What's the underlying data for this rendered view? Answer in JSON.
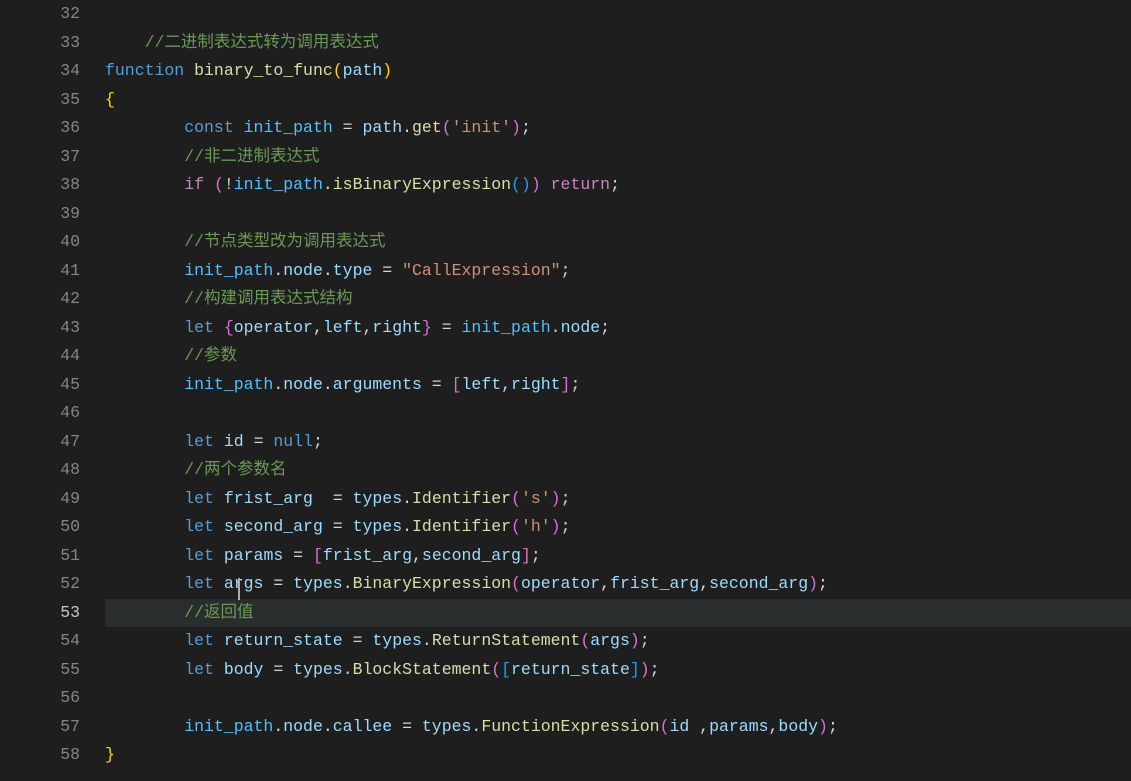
{
  "editor": {
    "activeLine": 53,
    "lines": [
      {
        "num": 32,
        "indent": 0
      },
      {
        "num": 33,
        "indent": 1,
        "tokens": [
          {
            "t": "comment",
            "v": "//二进制表达式转为调用表达式"
          }
        ]
      },
      {
        "num": 34,
        "indent": 0,
        "tokens": [
          {
            "t": "keyword-decl",
            "v": "function"
          },
          {
            "t": "punct",
            "v": " "
          },
          {
            "t": "func-name",
            "v": "binary_to_func"
          },
          {
            "t": "brace",
            "v": "("
          },
          {
            "t": "var",
            "v": "path"
          },
          {
            "t": "brace",
            "v": ")"
          }
        ]
      },
      {
        "num": 35,
        "indent": 0,
        "tokens": [
          {
            "t": "brace",
            "v": "{"
          }
        ]
      },
      {
        "num": 36,
        "indent": 2,
        "tokens": [
          {
            "t": "keyword-decl",
            "v": "const"
          },
          {
            "t": "punct",
            "v": " "
          },
          {
            "t": "const",
            "v": "init_path"
          },
          {
            "t": "punct",
            "v": " "
          },
          {
            "t": "operator",
            "v": "="
          },
          {
            "t": "punct",
            "v": " "
          },
          {
            "t": "var",
            "v": "path"
          },
          {
            "t": "punct",
            "v": "."
          },
          {
            "t": "func-name",
            "v": "get"
          },
          {
            "t": "brace2",
            "v": "("
          },
          {
            "t": "string",
            "v": "'init'"
          },
          {
            "t": "brace2",
            "v": ")"
          },
          {
            "t": "punct",
            "v": ";"
          }
        ]
      },
      {
        "num": 37,
        "indent": 2,
        "tokens": [
          {
            "t": "comment",
            "v": "//非二进制表达式"
          }
        ]
      },
      {
        "num": 38,
        "indent": 2,
        "tokens": [
          {
            "t": "keyword-ctrl",
            "v": "if"
          },
          {
            "t": "punct",
            "v": " "
          },
          {
            "t": "brace2",
            "v": "("
          },
          {
            "t": "operator",
            "v": "!"
          },
          {
            "t": "const",
            "v": "init_path"
          },
          {
            "t": "punct",
            "v": "."
          },
          {
            "t": "func-name",
            "v": "isBinaryExpression"
          },
          {
            "t": "brace3",
            "v": "("
          },
          {
            "t": "brace3",
            "v": ")"
          },
          {
            "t": "brace2",
            "v": ")"
          },
          {
            "t": "punct",
            "v": " "
          },
          {
            "t": "keyword-ctrl",
            "v": "return"
          },
          {
            "t": "punct",
            "v": ";"
          }
        ]
      },
      {
        "num": 39,
        "indent": 0
      },
      {
        "num": 40,
        "indent": 2,
        "tokens": [
          {
            "t": "comment",
            "v": "//节点类型改为调用表达式"
          }
        ]
      },
      {
        "num": 41,
        "indent": 2,
        "tokens": [
          {
            "t": "const",
            "v": "init_path"
          },
          {
            "t": "punct",
            "v": "."
          },
          {
            "t": "var",
            "v": "node"
          },
          {
            "t": "punct",
            "v": "."
          },
          {
            "t": "var",
            "v": "type"
          },
          {
            "t": "punct",
            "v": " "
          },
          {
            "t": "operator",
            "v": "="
          },
          {
            "t": "punct",
            "v": " "
          },
          {
            "t": "string",
            "v": "\"CallExpression\""
          },
          {
            "t": "punct",
            "v": ";"
          }
        ]
      },
      {
        "num": 42,
        "indent": 2,
        "tokens": [
          {
            "t": "comment",
            "v": "//构建调用表达式结构"
          }
        ]
      },
      {
        "num": 43,
        "indent": 2,
        "tokens": [
          {
            "t": "keyword-decl",
            "v": "let"
          },
          {
            "t": "punct",
            "v": " "
          },
          {
            "t": "brace2",
            "v": "{"
          },
          {
            "t": "var",
            "v": "operator"
          },
          {
            "t": "punct",
            "v": ","
          },
          {
            "t": "var",
            "v": "left"
          },
          {
            "t": "punct",
            "v": ","
          },
          {
            "t": "var",
            "v": "right"
          },
          {
            "t": "brace2",
            "v": "}"
          },
          {
            "t": "punct",
            "v": " "
          },
          {
            "t": "operator",
            "v": "="
          },
          {
            "t": "punct",
            "v": " "
          },
          {
            "t": "const",
            "v": "init_path"
          },
          {
            "t": "punct",
            "v": "."
          },
          {
            "t": "var",
            "v": "node"
          },
          {
            "t": "punct",
            "v": ";"
          }
        ]
      },
      {
        "num": 44,
        "indent": 2,
        "tokens": [
          {
            "t": "comment",
            "v": "//参数"
          }
        ]
      },
      {
        "num": 45,
        "indent": 2,
        "tokens": [
          {
            "t": "const",
            "v": "init_path"
          },
          {
            "t": "punct",
            "v": "."
          },
          {
            "t": "var",
            "v": "node"
          },
          {
            "t": "punct",
            "v": "."
          },
          {
            "t": "var",
            "v": "arguments"
          },
          {
            "t": "punct",
            "v": " "
          },
          {
            "t": "operator",
            "v": "="
          },
          {
            "t": "punct",
            "v": " "
          },
          {
            "t": "brace2",
            "v": "["
          },
          {
            "t": "var",
            "v": "left"
          },
          {
            "t": "punct",
            "v": ","
          },
          {
            "t": "var",
            "v": "right"
          },
          {
            "t": "brace2",
            "v": "]"
          },
          {
            "t": "punct",
            "v": ";"
          }
        ]
      },
      {
        "num": 46,
        "indent": 0
      },
      {
        "num": 47,
        "indent": 2,
        "tokens": [
          {
            "t": "keyword-decl",
            "v": "let"
          },
          {
            "t": "punct",
            "v": " "
          },
          {
            "t": "var",
            "v": "id"
          },
          {
            "t": "punct",
            "v": " "
          },
          {
            "t": "operator",
            "v": "="
          },
          {
            "t": "punct",
            "v": " "
          },
          {
            "t": "null",
            "v": "null"
          },
          {
            "t": "punct",
            "v": ";"
          }
        ]
      },
      {
        "num": 48,
        "indent": 2,
        "tokens": [
          {
            "t": "comment",
            "v": "//两个参数名"
          }
        ]
      },
      {
        "num": 49,
        "indent": 2,
        "tokens": [
          {
            "t": "keyword-decl",
            "v": "let"
          },
          {
            "t": "punct",
            "v": " "
          },
          {
            "t": "var",
            "v": "frist_arg"
          },
          {
            "t": "punct",
            "v": "  "
          },
          {
            "t": "operator",
            "v": "="
          },
          {
            "t": "punct",
            "v": " "
          },
          {
            "t": "var",
            "v": "types"
          },
          {
            "t": "punct",
            "v": "."
          },
          {
            "t": "func-name",
            "v": "Identifier"
          },
          {
            "t": "brace2",
            "v": "("
          },
          {
            "t": "string",
            "v": "'s'"
          },
          {
            "t": "brace2",
            "v": ")"
          },
          {
            "t": "punct",
            "v": ";"
          }
        ]
      },
      {
        "num": 50,
        "indent": 2,
        "tokens": [
          {
            "t": "keyword-decl",
            "v": "let"
          },
          {
            "t": "punct",
            "v": " "
          },
          {
            "t": "var",
            "v": "second_arg"
          },
          {
            "t": "punct",
            "v": " "
          },
          {
            "t": "operator",
            "v": "="
          },
          {
            "t": "punct",
            "v": " "
          },
          {
            "t": "var",
            "v": "types"
          },
          {
            "t": "punct",
            "v": "."
          },
          {
            "t": "func-name",
            "v": "Identifier"
          },
          {
            "t": "brace2",
            "v": "("
          },
          {
            "t": "string",
            "v": "'h'"
          },
          {
            "t": "brace2",
            "v": ")"
          },
          {
            "t": "punct",
            "v": ";"
          }
        ]
      },
      {
        "num": 51,
        "indent": 2,
        "tokens": [
          {
            "t": "keyword-decl",
            "v": "let"
          },
          {
            "t": "punct",
            "v": " "
          },
          {
            "t": "var",
            "v": "params"
          },
          {
            "t": "punct",
            "v": " "
          },
          {
            "t": "operator",
            "v": "="
          },
          {
            "t": "punct",
            "v": " "
          },
          {
            "t": "brace2",
            "v": "["
          },
          {
            "t": "var",
            "v": "frist_arg"
          },
          {
            "t": "punct",
            "v": ","
          },
          {
            "t": "var",
            "v": "second_arg"
          },
          {
            "t": "brace2",
            "v": "]"
          },
          {
            "t": "punct",
            "v": ";"
          }
        ]
      },
      {
        "num": 52,
        "indent": 2,
        "tokens": [
          {
            "t": "keyword-decl",
            "v": "let"
          },
          {
            "t": "punct",
            "v": " "
          },
          {
            "t": "var",
            "v": "args"
          },
          {
            "t": "punct",
            "v": " "
          },
          {
            "t": "operator",
            "v": "="
          },
          {
            "t": "punct",
            "v": " "
          },
          {
            "t": "var",
            "v": "types"
          },
          {
            "t": "punct",
            "v": "."
          },
          {
            "t": "func-name",
            "v": "BinaryExpression"
          },
          {
            "t": "brace2",
            "v": "("
          },
          {
            "t": "var",
            "v": "operator"
          },
          {
            "t": "punct",
            "v": ","
          },
          {
            "t": "var",
            "v": "frist_arg"
          },
          {
            "t": "punct",
            "v": ","
          },
          {
            "t": "var",
            "v": "second_arg"
          },
          {
            "t": "brace2",
            "v": ")"
          },
          {
            "t": "punct",
            "v": ";"
          }
        ]
      },
      {
        "num": 53,
        "indent": 2,
        "tokens": [
          {
            "t": "comment",
            "v": "//返回值"
          }
        ]
      },
      {
        "num": 54,
        "indent": 2,
        "tokens": [
          {
            "t": "keyword-decl",
            "v": "let"
          },
          {
            "t": "punct",
            "v": " "
          },
          {
            "t": "var",
            "v": "return_state"
          },
          {
            "t": "punct",
            "v": " "
          },
          {
            "t": "operator",
            "v": "="
          },
          {
            "t": "punct",
            "v": " "
          },
          {
            "t": "var",
            "v": "types"
          },
          {
            "t": "punct",
            "v": "."
          },
          {
            "t": "func-name",
            "v": "ReturnStatement"
          },
          {
            "t": "brace2",
            "v": "("
          },
          {
            "t": "var",
            "v": "args"
          },
          {
            "t": "brace2",
            "v": ")"
          },
          {
            "t": "punct",
            "v": ";"
          }
        ]
      },
      {
        "num": 55,
        "indent": 2,
        "tokens": [
          {
            "t": "keyword-decl",
            "v": "let"
          },
          {
            "t": "punct",
            "v": " "
          },
          {
            "t": "var",
            "v": "body"
          },
          {
            "t": "punct",
            "v": " "
          },
          {
            "t": "operator",
            "v": "="
          },
          {
            "t": "punct",
            "v": " "
          },
          {
            "t": "var",
            "v": "types"
          },
          {
            "t": "punct",
            "v": "."
          },
          {
            "t": "func-name",
            "v": "BlockStatement"
          },
          {
            "t": "brace2",
            "v": "("
          },
          {
            "t": "brace3",
            "v": "["
          },
          {
            "t": "var",
            "v": "return_state"
          },
          {
            "t": "brace3",
            "v": "]"
          },
          {
            "t": "brace2",
            "v": ")"
          },
          {
            "t": "punct",
            "v": ";"
          }
        ]
      },
      {
        "num": 56,
        "indent": 0
      },
      {
        "num": 57,
        "indent": 2,
        "tokens": [
          {
            "t": "const",
            "v": "init_path"
          },
          {
            "t": "punct",
            "v": "."
          },
          {
            "t": "var",
            "v": "node"
          },
          {
            "t": "punct",
            "v": "."
          },
          {
            "t": "var",
            "v": "callee"
          },
          {
            "t": "punct",
            "v": " "
          },
          {
            "t": "operator",
            "v": "="
          },
          {
            "t": "punct",
            "v": " "
          },
          {
            "t": "var",
            "v": "types"
          },
          {
            "t": "punct",
            "v": "."
          },
          {
            "t": "func-name",
            "v": "FunctionExpression"
          },
          {
            "t": "brace2",
            "v": "("
          },
          {
            "t": "var",
            "v": "id"
          },
          {
            "t": "punct",
            "v": " ,"
          },
          {
            "t": "var",
            "v": "params"
          },
          {
            "t": "punct",
            "v": ","
          },
          {
            "t": "var",
            "v": "body"
          },
          {
            "t": "brace2",
            "v": ")"
          },
          {
            "t": "punct",
            "v": ";"
          }
        ]
      },
      {
        "num": 58,
        "indent": 0,
        "tokens": [
          {
            "t": "brace",
            "v": "}"
          }
        ]
      }
    ]
  }
}
